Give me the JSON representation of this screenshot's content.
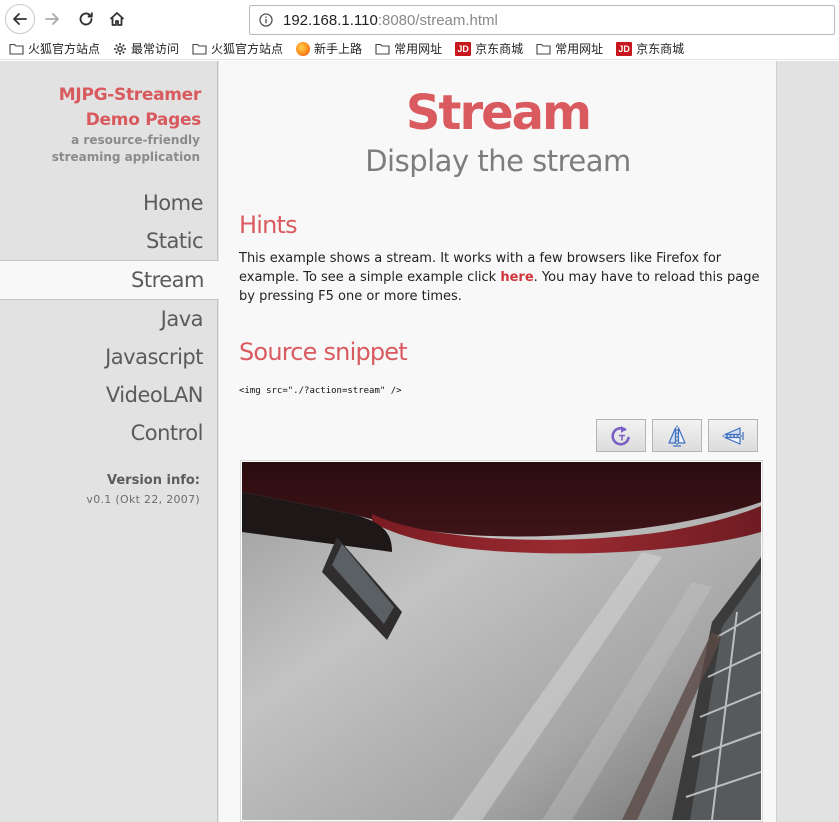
{
  "browser": {
    "url_host": "192.168.1.110",
    "url_port": ":8080",
    "url_path": "/stream.html",
    "bookmarks": [
      {
        "label": "火狐官方站点",
        "icon": "folder-icon"
      },
      {
        "label": "最常访问",
        "icon": "gear-icon"
      },
      {
        "label": "火狐官方站点",
        "icon": "folder-icon"
      },
      {
        "label": "新手上路",
        "icon": "firefox-icon"
      },
      {
        "label": "常用网址",
        "icon": "folder-icon"
      },
      {
        "label": "京东商城",
        "icon": "jd-icon"
      },
      {
        "label": "常用网址",
        "icon": "folder-icon"
      },
      {
        "label": "京东商城",
        "icon": "jd-icon"
      }
    ],
    "jd_badge": "JD"
  },
  "sidebar": {
    "brand_line1": "MJPG-Streamer",
    "brand_line2": "Demo Pages",
    "tagline": "a resource-friendly streaming application",
    "menu": [
      {
        "label": "Home",
        "active": false
      },
      {
        "label": "Static",
        "active": false
      },
      {
        "label": "Stream",
        "active": true
      },
      {
        "label": "Java",
        "active": false
      },
      {
        "label": "Javascript",
        "active": false
      },
      {
        "label": "VideoLAN",
        "active": false
      },
      {
        "label": "Control",
        "active": false
      }
    ],
    "version_title": "Version info:",
    "version_value": "v0.1 (Okt 22, 2007)"
  },
  "content": {
    "title": "Stream",
    "subtitle": "Display the stream",
    "hints_heading": "Hints",
    "hints_before": "This example shows a stream. It works with a few browsers like Firefox for example. To see a simple example click ",
    "hints_link": "here",
    "hints_after": ". You may have to reload this page by pressing F5 one or more times.",
    "snippet_heading": "Source snippet",
    "snippet_code": "<img src=\"./?action=stream\" />",
    "controls": [
      {
        "name": "rotate-button",
        "icon": "rotate-icon"
      },
      {
        "name": "flip-vertical-button",
        "icon": "flip-vertical-icon"
      },
      {
        "name": "flip-horizontal-button",
        "icon": "flip-horizontal-icon"
      }
    ]
  },
  "colors": {
    "accent": "#d95b5f",
    "sidebar_bg": "#e2e2e2",
    "content_bg": "#f8f8f8",
    "link": "#d0363b"
  }
}
